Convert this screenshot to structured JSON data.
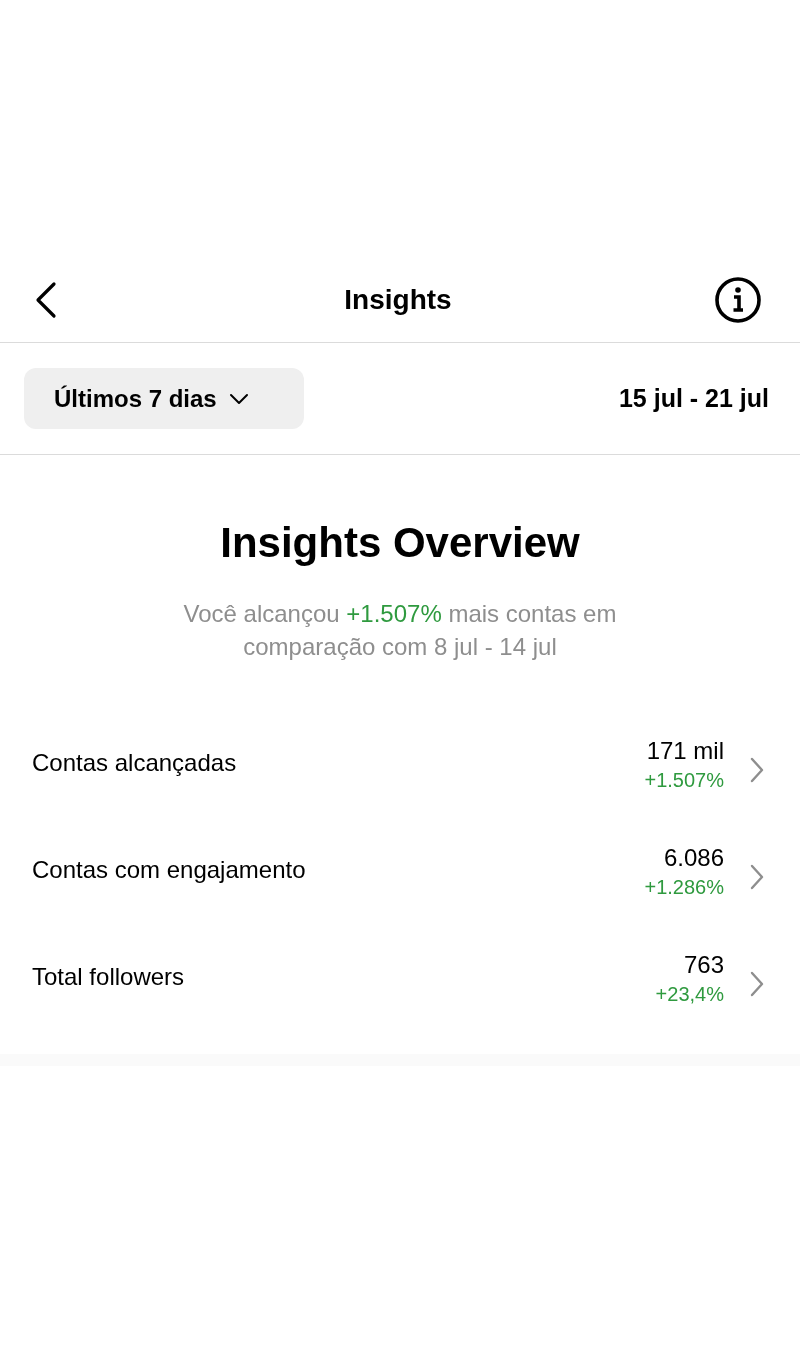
{
  "header": {
    "title": "Insights"
  },
  "filter": {
    "period": "Últimos 7 dias",
    "date_range": "15 jul - 21 jul"
  },
  "overview": {
    "title": "Insights Overview",
    "summary": {
      "before": "Você alcançou ",
      "change": "+1.507%",
      "after": " mais contas em comparação com 8 jul - 14 jul"
    }
  },
  "metrics": [
    {
      "label": "Contas alcançadas",
      "value": "171 mil",
      "change": "+1.507%"
    },
    {
      "label": "Contas com engajamento",
      "value": "6.086",
      "change": "+1.286%"
    },
    {
      "label": "Total followers",
      "value": "763",
      "change": "+23,4%"
    }
  ]
}
